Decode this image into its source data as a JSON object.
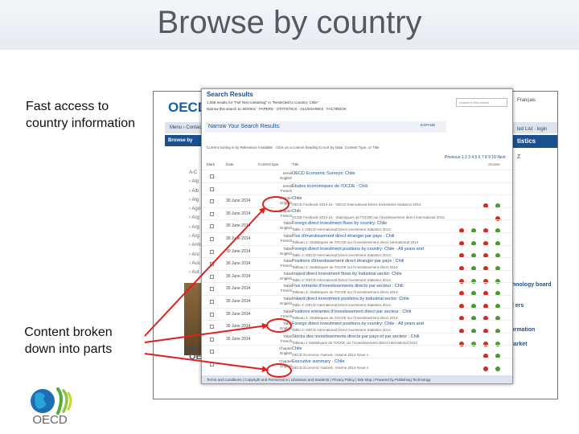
{
  "slide": {
    "title": "Browse by country",
    "callout_top": "Fast access to country information",
    "callout_bottom": "Content broken down into parts"
  },
  "site": {
    "logo": "OECD",
    "nav": "Menu › Contact",
    "browse": "Browse by",
    "left_items": [
      "A-C",
      "› Alg",
      "› Alb",
      "› Alg",
      "› Ago",
      "› Arg",
      "› Arg",
      "› Arg",
      "› Arm",
      "› Aru",
      "› Aus",
      "› Aut"
    ],
    "right": {
      "language": "Français",
      "list": "ted List · login",
      "stat_tab": "tistics",
      "z_link": "Z",
      "block1_title": "chnology board",
      "block2_title": "al ers",
      "block3_title": "formation",
      "block4_title": "Market"
    },
    "bottom_oecd": "OECD",
    "footer_logo": "OECD"
  },
  "results": {
    "title": "Search Results",
    "search_box": "Search in this search",
    "count": "1,085 results for \"Full Text containing\" in \"Restricted to Country: Chile\"",
    "refine": "Narrow this search to: BOOKS · PAPERS · STATISTICS · GLOSSARIES · FACTBOOK",
    "narrow": "Narrow Your Search Results:",
    "expand": "EXPAND",
    "sortline": "Current sorting is by Relevance Available · Click on a column heading to sort by Date, Content Type, or Title",
    "pager": "Previous 1 2 3 4 5 6 7 8 9 10 Next",
    "columns": {
      "select": "Mark",
      "date": "Date",
      "type": "Content type",
      "title": "Title",
      "access": "Access"
    },
    "rows": [
      {
        "date": "",
        "type": "Serial English",
        "title": "OECD Economic Surveys: Chile",
        "sub": "",
        "icons": ""
      },
      {
        "date": "",
        "type": "Serial French",
        "title": "Études économiques de l'OCDE : Chili",
        "sub": "",
        "icons": ""
      },
      {
        "date": "30 June 2014",
        "type": "Chapter English",
        "title": "Chile",
        "sub": "OECD Factbook 2014-15 · OECD International Direct Investment Statistics 2014",
        "icons": "rg"
      },
      {
        "date": "30 June 2014",
        "type": "Chapter French",
        "title": "Chili",
        "sub": "OCDE Factbook 2014-15 · Statistiques de l'OCDE sur l'investissement direct international 2014",
        "icons": "r"
      },
      {
        "date": "30 June 2014",
        "type": "Table English",
        "title": "Foreign direct investment flows by country: Chile",
        "sub": "Table 1: OECD International Direct Investment Statistics 2014",
        "icons": "rgrg"
      },
      {
        "date": "30 June 2014",
        "type": "Table French",
        "title": "Flux d'investissement direct étranger par pays : Chili",
        "sub": "Tableau 1: Statistiques de l'OCDE sur l'investissement direct international 2014",
        "icons": "rgrg"
      },
      {
        "date": "30 June 2014",
        "type": "Table English",
        "title": "Foreign direct investment positions by country: Chile - All years and",
        "sub": "Table 2: OECD International Direct Investment Statistics 2014",
        "icons": "rgrg"
      },
      {
        "date": "30 June 2014",
        "type": "Table French",
        "title": "Positions d'investissement direct étranger par pays : Chili",
        "sub": "Tableau 2: Statistiques de l'OCDE sur l'investissement direct 2014",
        "icons": "rgrg"
      },
      {
        "date": "30 June 2014",
        "type": "Table English",
        "title": "Inward direct investment flows by industrial sector: Chile",
        "sub": "Table 3: OECD International Direct Investment Statistics 2014",
        "icons": "rgrg"
      },
      {
        "date": "30 June 2014",
        "type": "Table French",
        "title": "Flux entrants d'investissements directs par secteur : Chili",
        "sub": "Tableau 3: Statistiques de l'OCDE sur l'investissement direct 2014",
        "icons": "rgrg"
      },
      {
        "date": "30 June 2014",
        "type": "Table English",
        "title": "Inward direct investment positions by industrial sector: Chile",
        "sub": "Table 4: OECD International Direct Investment Statistics 2014",
        "icons": "rgrg"
      },
      {
        "date": "30 June 2014",
        "type": "Table French",
        "title": "Positions entrantes d'investissement direct par secteur : Chili",
        "sub": "Tableau 4: Statistiques de l'OCDE sur l'investissement direct 2014",
        "icons": "rgrg"
      },
      {
        "date": "30 June 2014",
        "type": "Table English",
        "title": "Foreign direct investment positions by country: Chile - All years and",
        "sub": "Table 2: OECD International Direct Investment Statistics 2014",
        "icons": "rgrg"
      },
      {
        "date": "30 June 2014",
        "type": "Table French",
        "title": "Stocks des investissements directs par pays et par secteur : Chili",
        "sub": "Tableau 4 Statistiques de l'OCDE sur l'investissement direct international 2014",
        "icons": "rgrg"
      },
      {
        "date": "",
        "type": "Chapter English",
        "title": "Chile",
        "sub": "OECD Economic Outlook, Volume 2014 Issue 1",
        "icons": "rg"
      },
      {
        "date": "",
        "type": "Chapter English",
        "title": "Executive summary - Chile",
        "sub": "OECD Economic Outlook, Volume 2014 Issue 1",
        "icons": "rg"
      }
    ],
    "footer": "Terms and Conditions | Copyright and Permissions | Librarians and Students | Privacy Policy | Site Map | Powered by Publishing Technology"
  },
  "logo_text": "OECD",
  "colors": {
    "title": "#555a61",
    "arrow": "#e0201b",
    "brand_blue": "#1b4f8f"
  }
}
